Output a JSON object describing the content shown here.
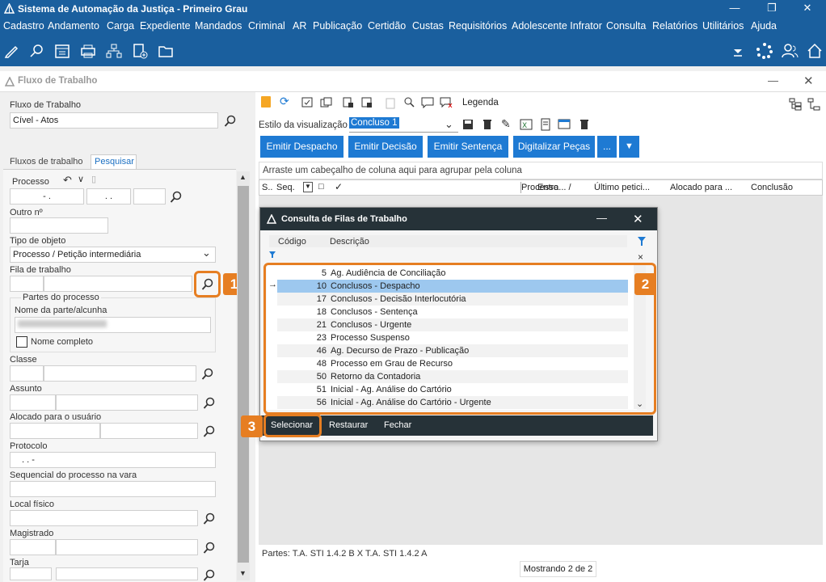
{
  "window": {
    "title": "Sistema de Automação da Justiça - Primeiro Grau"
  },
  "menu": [
    "Cadastro",
    "Andamento",
    "Carga",
    "Expediente",
    "Mandados",
    "Criminal",
    "AR",
    "Publicação",
    "Certidão",
    "Custas",
    "Requisitórios",
    "Adolescente Infrator",
    "Consulta",
    "Relatórios",
    "Utilitários",
    "Ajuda"
  ],
  "panel": {
    "title": "Fluxo de Trabalho"
  },
  "left": {
    "fluxo_label": "Fluxo de Trabalho",
    "fluxo_value": "Cível - Atos",
    "tabs": [
      "Fluxos de trabalho",
      "Pesquisar"
    ],
    "processo_label": "Processo",
    "processo_p1": "- .",
    "processo_p2": ". .",
    "outro_label": "Outro nº",
    "tipo_label": "Tipo de objeto",
    "tipo_value": "Processo / Petição intermediária",
    "fila_label": "Fila de trabalho",
    "partes_label": "Partes do processo",
    "nome_label": "Nome da parte/alcunha",
    "nome_completo": "Nome completo",
    "classe_label": "Classe",
    "assunto_label": "Assunto",
    "alocado_label": "Alocado para o usuário",
    "protocolo_label": "Protocolo",
    "protocolo_value": ". . -",
    "sequencial_label": "Sequencial do processo na vara",
    "local_label": "Local físico",
    "magistrado_label": "Magistrado",
    "tarja_label": "Tarja"
  },
  "right": {
    "legenda": "Legenda",
    "estilo_label": "Estilo da visualização",
    "estilo_value": "Concluso 1",
    "buttons": [
      "Emitir Despacho",
      "Emitir Decisão",
      "Emitir Sentença",
      "Digitalizar Peças",
      "..."
    ],
    "group_hint": "Arraste um cabeçalho de coluna aqui para agrupar pela coluna",
    "columns": [
      "S..",
      "Seq.",
      "Processo",
      "Entra... /",
      "Último petici...",
      "Alocado para ...",
      "Conclusão"
    ],
    "status": "Partes: T.A. STI 1.4.2 B  X  T.A. STI 1.4.2 A",
    "mostrando": "Mostrando 2 de 2"
  },
  "dialog": {
    "title": "Consulta de Filas de Trabalho",
    "col_codigo": "Código",
    "col_descricao": "Descrição",
    "rows": [
      {
        "code": "5",
        "desc": "Ag. Audiência de Conciliação"
      },
      {
        "code": "10",
        "desc": "Conclusos - Despacho"
      },
      {
        "code": "17",
        "desc": "Conclusos - Decisão Interlocutória"
      },
      {
        "code": "18",
        "desc": "Conclusos - Sentença"
      },
      {
        "code": "21",
        "desc": "Conclusos - Urgente"
      },
      {
        "code": "23",
        "desc": "Processo Suspenso"
      },
      {
        "code": "46",
        "desc": "Ag. Decurso de Prazo - Publicação"
      },
      {
        "code": "48",
        "desc": "Processo em Grau de Recurso"
      },
      {
        "code": "50",
        "desc": "Retorno da Contadoria"
      },
      {
        "code": "51",
        "desc": "Inicial - Ag. Análise do Cartório"
      },
      {
        "code": "56",
        "desc": "Inicial - Ag. Análise do Cartório - Urgente"
      }
    ],
    "selected_row": 1,
    "footer": [
      "Selecionar",
      "Restaurar",
      "Fechar"
    ]
  },
  "badges": [
    "1",
    "2",
    "3"
  ],
  "colors": {
    "brand": "#1a5f9e",
    "accent": "#1e7ad3",
    "highlight": "#e67e22",
    "dialog_header": "#263238",
    "selected": "#9dc8ef"
  }
}
